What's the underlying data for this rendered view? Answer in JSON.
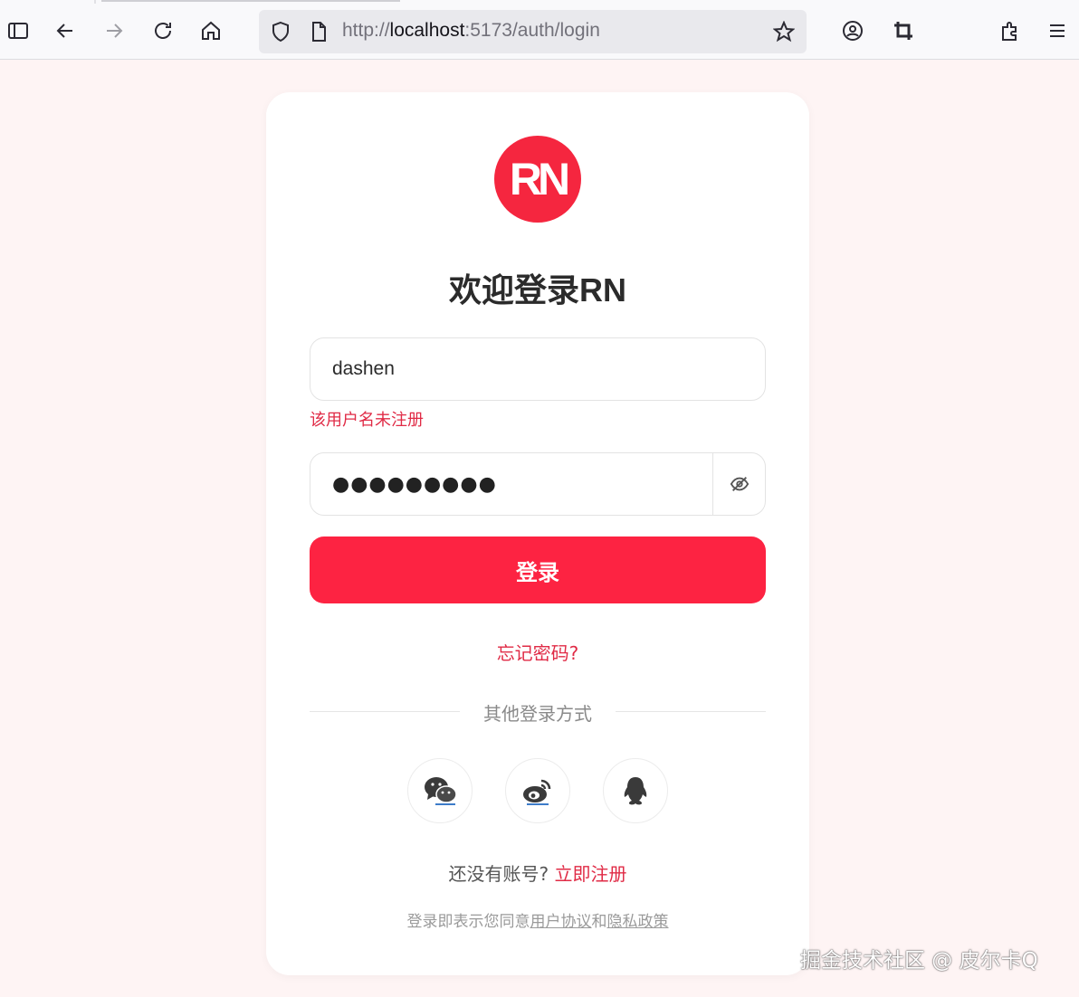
{
  "browser": {
    "url_scheme": "http://",
    "url_host": "localhost",
    "url_rest": ":5173/auth/login",
    "icons": [
      "sidebar-icon",
      "back-icon",
      "forward-icon",
      "reload-icon",
      "home-icon",
      "shield-icon",
      "page-icon",
      "bookmark-star-icon",
      "account-icon",
      "crop-icon",
      "extensions-icon",
      "menu-icon"
    ]
  },
  "login": {
    "logo_text": "RN",
    "title": "欢迎登录RN",
    "username_value": "dashen",
    "username_error": "该用户名未注册",
    "password_masked": "●●●●●●●●●",
    "login_button": "登录",
    "forgot_password": "忘记密码?",
    "other_methods": "其他登录方式",
    "social": [
      "wechat-icon",
      "weibo-icon",
      "qq-icon"
    ],
    "no_account": "还没有账号?",
    "register_now": "立即注册",
    "terms_prefix": "登录即表示您同意",
    "user_agreement": "用户协议",
    "terms_and": "和",
    "privacy_policy": "隐私政策"
  },
  "watermark": "掘金技术社区 @ 皮尔卡Q",
  "colors": {
    "accent": "#fd2342",
    "error": "#e02b46",
    "page_bg": "#fef4f4"
  }
}
